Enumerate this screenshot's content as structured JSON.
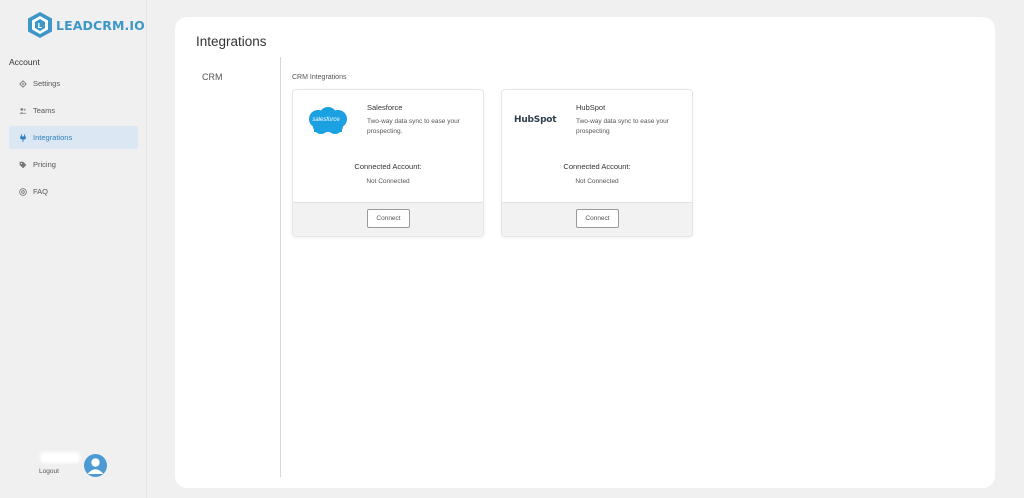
{
  "brand": {
    "name": "LEADCRM.IO",
    "accent": "#3d97c9"
  },
  "sidebar": {
    "section_label": "Account",
    "items": [
      {
        "label": "Settings",
        "icon": "gear-icon",
        "active": false
      },
      {
        "label": "Teams",
        "icon": "users-icon",
        "active": false
      },
      {
        "label": "Integrations",
        "icon": "plug-icon",
        "active": true
      },
      {
        "label": "Pricing",
        "icon": "tag-icon",
        "active": false
      },
      {
        "label": "FAQ",
        "icon": "help-circle-icon",
        "active": false
      }
    ],
    "logout_label": "Logout",
    "avatar_icon": "user-avatar-icon"
  },
  "main": {
    "title": "Integrations",
    "subnav": [
      {
        "label": "CRM"
      }
    ],
    "section_heading": "CRM Integrations",
    "cards": [
      {
        "name": "Salesforce",
        "logo_text": "salesforce",
        "description": "Two-way data sync to ease your prospecting.",
        "connected_label": "Connected Account:",
        "connected_value": "Not Connected",
        "button_label": "Connect"
      },
      {
        "name": "HubSpot",
        "logo_text": "HubSpot",
        "description": "Two-way data sync to ease your prospecting",
        "connected_label": "Connected Account:",
        "connected_value": "Not Connected",
        "button_label": "Connect"
      }
    ]
  },
  "colors": {
    "active_bg": "#dbe8f4",
    "active_text": "#2f7fc1",
    "salesforce_blue": "#1ba1e2",
    "avatar": "#4b9ad3"
  }
}
